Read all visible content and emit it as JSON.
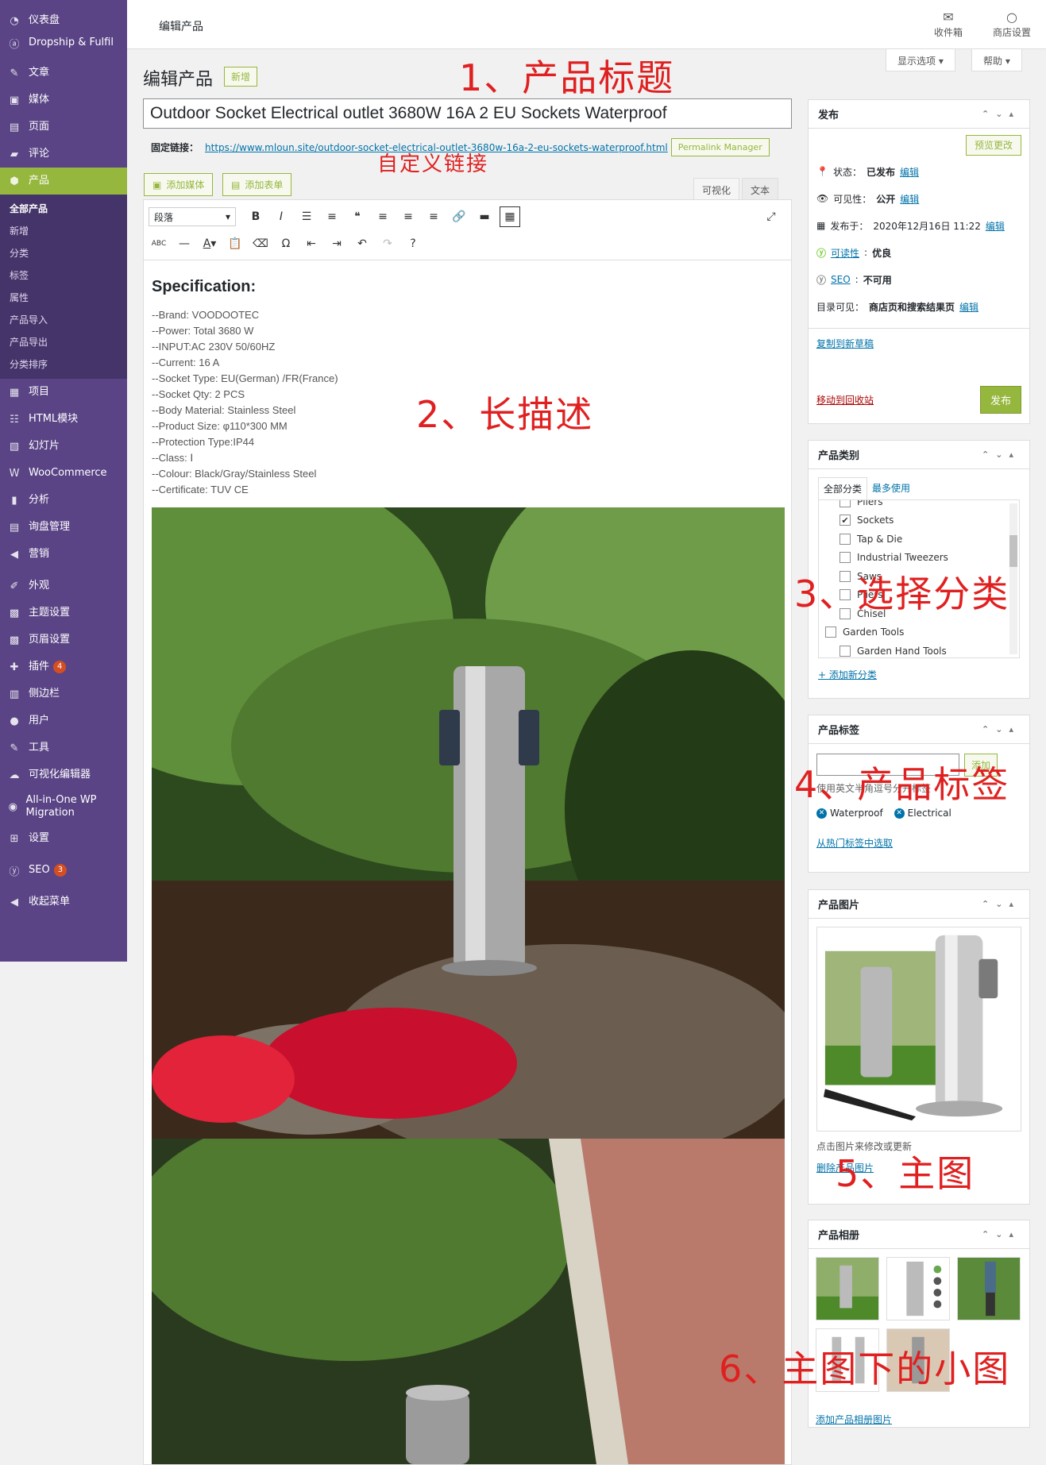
{
  "sidebar": {
    "items": [
      {
        "label": "仪表盘",
        "icon": "dashboard-icon"
      },
      {
        "label": "Dropship & Fulfil",
        "icon": "dropship-icon"
      },
      {
        "label": "文章",
        "icon": "pin-icon"
      },
      {
        "label": "媒体",
        "icon": "media-icon"
      },
      {
        "label": "页面",
        "icon": "page-icon"
      },
      {
        "label": "评论",
        "icon": "comment-icon"
      },
      {
        "label": "产品",
        "icon": "product-icon"
      },
      {
        "label": "项目",
        "icon": "project-icon"
      },
      {
        "label": "HTML模块",
        "icon": "html-module-icon"
      },
      {
        "label": "幻灯片",
        "icon": "slides-icon"
      },
      {
        "label": "WooCommerce",
        "icon": "woocommerce-icon"
      },
      {
        "label": "分析",
        "icon": "analytics-icon"
      },
      {
        "label": "询盘管理",
        "icon": "inquiry-icon"
      },
      {
        "label": "营销",
        "icon": "megaphone-icon"
      },
      {
        "label": "外观",
        "icon": "brush-icon"
      },
      {
        "label": "主题设置",
        "icon": "theme-settings-icon"
      },
      {
        "label": "页眉设置",
        "icon": "header-settings-icon"
      },
      {
        "label": "插件",
        "icon": "plugin-icon",
        "badge": "4"
      },
      {
        "label": "侧边栏",
        "icon": "sidebar-icon"
      },
      {
        "label": "用户",
        "icon": "user-icon"
      },
      {
        "label": "工具",
        "icon": "tools-icon"
      },
      {
        "label": "可视化编辑器",
        "icon": "visual-editor-icon"
      },
      {
        "label": "All-in-One WP Migration",
        "icon": "migration-icon"
      },
      {
        "label": "设置",
        "icon": "settings-icon"
      },
      {
        "label": "SEO",
        "icon": "seo-icon",
        "badge": "3"
      },
      {
        "label": "收起菜单",
        "icon": "collapse-icon"
      }
    ],
    "product_sub": [
      "全部产品",
      "新增",
      "分类",
      "标签",
      "属性",
      "产品导入",
      "产品导出",
      "分类排序"
    ]
  },
  "topbar": {
    "title": "编辑产品",
    "inbox": "收件箱",
    "store_settings": "商店设置",
    "screen_options": "显示选项",
    "help": "帮助"
  },
  "page": {
    "heading": "编辑产品",
    "new_button": "新增"
  },
  "annotations": {
    "a1": "1、产品标题",
    "a1b": "自定义链接",
    "a2": "2、长描述",
    "a3": "3、选择分类",
    "a4": "4、产品标签",
    "a5": "5、主图",
    "a6": "6、主图下的小图"
  },
  "product": {
    "title": "Outdoor Socket Electrical outlet 3680W 16A 2 EU Sockets Waterproof",
    "permalink_label": "固定链接：",
    "permalink_url": "https://www.mloun.site/outdoor-socket-electrical-outlet-3680w-16a-2-eu-sockets-waterproof.html",
    "permalink_manager": "Permalink Manager"
  },
  "editor": {
    "add_media": "添加媒体",
    "add_form": "添加表单",
    "tab_visual": "可视化",
    "tab_text": "文本",
    "format": "段落",
    "spec_heading": "Specification:",
    "spec_lines": [
      "--Brand: VOODOOTEC",
      "--Power: Total 3680 W",
      "--INPUT:AC 230V 50/60HZ",
      "--Current: 16 A",
      "--Socket Type: EU(German) /FR(France)",
      "--Socket Qty: 2 PCS",
      "--Body Material: Stainless Steel",
      "--Product Size: φ110*300 MM",
      "--Protection Type:IP44",
      "--Class: Ⅰ",
      "--Colour: Black/Gray/Stainless Steel",
      "--Certificate: TUV CE"
    ]
  },
  "publish": {
    "title": "发布",
    "preview": "预览更改",
    "status_label": "状态：",
    "status_value": "已发布",
    "edit": "编辑",
    "visibility_label": "可见性：",
    "visibility_value": "公开",
    "published_label": "发布于：",
    "published_value": "2020年12月16日 11:22",
    "readability_label": "可读性",
    "readability_value": "优良",
    "seo_label": "SEO",
    "seo_value": "不可用",
    "catalog_label": "目录可见：",
    "catalog_value": "商店页和搜索结果页",
    "copy_draft": "复制到新草稿",
    "trash": "移动到回收站",
    "publish_btn": "发布"
  },
  "categories": {
    "title": "产品类别",
    "tab_all": "全部分类",
    "tab_popular": "最多使用",
    "items": [
      {
        "label": "Pliers",
        "checked": false,
        "indent": 1
      },
      {
        "label": "Sockets",
        "checked": true,
        "indent": 1
      },
      {
        "label": "Tap & Die",
        "checked": false,
        "indent": 1
      },
      {
        "label": "Industrial Tweezers",
        "checked": false,
        "indent": 1
      },
      {
        "label": "Saws",
        "checked": false,
        "indent": 1
      },
      {
        "label": "Pliers",
        "checked": false,
        "indent": 1
      },
      {
        "label": "Chisel",
        "checked": false,
        "indent": 1
      },
      {
        "label": "Garden Tools",
        "checked": false,
        "indent": 0
      },
      {
        "label": "Garden Hand Tools",
        "checked": false,
        "indent": 1
      }
    ],
    "add_new": "+ 添加新分类"
  },
  "tags": {
    "title": "产品标签",
    "add_btn": "添加",
    "hint": "使用英文半角逗号分开标签",
    "items": [
      "Waterproof",
      "Electrical"
    ],
    "choose": "从热门标签中选取"
  },
  "product_image": {
    "title": "产品图片",
    "hint": "点击图片来修改或更新",
    "remove": "删除产品图片"
  },
  "gallery": {
    "title": "产品相册",
    "add": "添加产品相册图片"
  },
  "colors": {
    "sidebar": "#5a4486",
    "accent": "#96b73e",
    "annotation": "#e02020",
    "link": "#0073aa"
  }
}
